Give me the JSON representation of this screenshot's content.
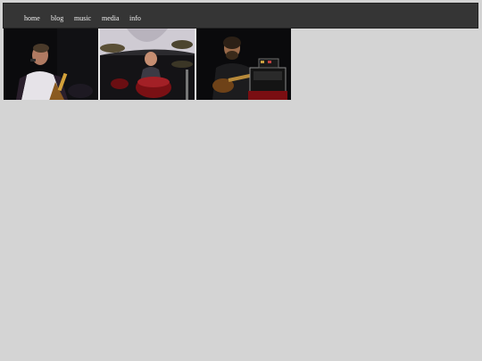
{
  "nav": {
    "items": [
      {
        "label": "home"
      },
      {
        "label": "blog"
      },
      {
        "label": "music"
      },
      {
        "label": "media"
      },
      {
        "label": "info"
      }
    ]
  },
  "gallery": {
    "photos": [
      {
        "subject": "singer-with-guitar"
      },
      {
        "subject": "drummer"
      },
      {
        "subject": "guitarist"
      }
    ]
  },
  "colors": {
    "page_background": "#d4d4d4",
    "navbar_background": "#353535",
    "nav_text": "#f0f0f0"
  }
}
